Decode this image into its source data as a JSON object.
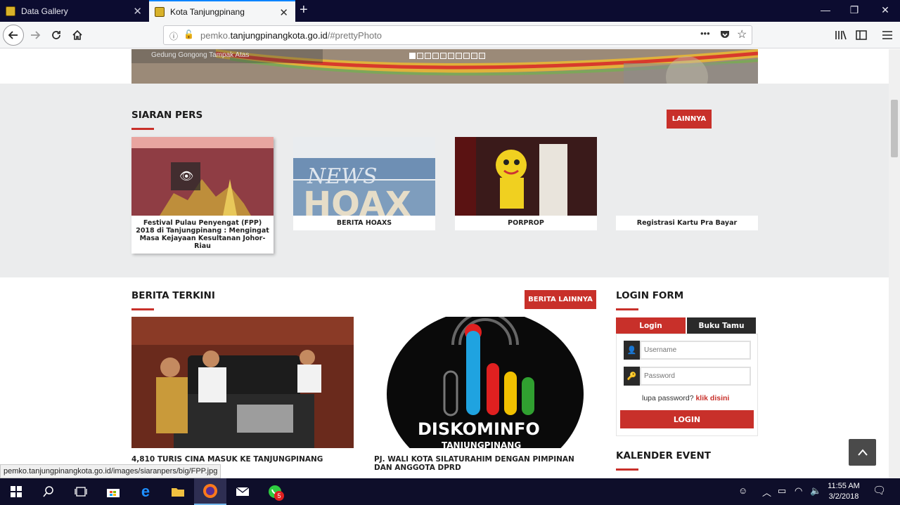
{
  "browser": {
    "tabs": [
      {
        "title": "Data Gallery",
        "active": false
      },
      {
        "title": "Kota Tanjungpinang",
        "active": true
      }
    ],
    "url": {
      "prefix": "pemko.",
      "domain": "tanjungpinangkota.go.id",
      "suffix": "/#prettyPhoto"
    },
    "menu_dots": "•••"
  },
  "hero": {
    "caption": "Gedung Gongong Tampak Atas",
    "slide_count": 10,
    "active_slide": 1
  },
  "siaran_pers": {
    "title": "SIARAN PERS",
    "more_button": "LAINNYA",
    "cards": [
      {
        "label": "Festival Pulau Penyengat (FPP) 2018 di Tanjungpinang : Mengingat Masa Kejayaan Kesultanan Johor-Riau"
      },
      {
        "label": "BERITA HOAXS"
      },
      {
        "label": "PORPROP"
      },
      {
        "label": "Registrasi Kartu Pra Bayar"
      }
    ]
  },
  "berita_terkini": {
    "title": "BERITA TERKINI",
    "more_button": "BERITA LAINNYA",
    "items": [
      {
        "title": "4,810 TURIS CINA MASUK KE TANJUNGPINANG\nARI."
      },
      {
        "title": "PJ. WALI KOTA SILATURAHIM DENGAN PIMPINAN DAN ANGGOTA DPRD"
      }
    ]
  },
  "login_form": {
    "title": "LOGIN FORM",
    "tab_login": "Login",
    "tab_guestbook": "Buku Tamu",
    "username_placeholder": "Username",
    "password_placeholder": "Password",
    "forgot_text": "lupa password?",
    "forgot_link": "klik disini",
    "login_button": "LOGIN"
  },
  "kalender": {
    "title": "KALENDER EVENT"
  },
  "status_bar_url": "pemko.tanjungpinangkota.go.id/images/siaranpers/big/FPP.jpg",
  "taskbar": {
    "time": "11:55 AM",
    "date": "3/2/2018",
    "whatsapp_badge": "5"
  },
  "colors": {
    "accent": "#c8302a",
    "dark": "#2a2a2a",
    "section_bg": "#ebeced"
  }
}
